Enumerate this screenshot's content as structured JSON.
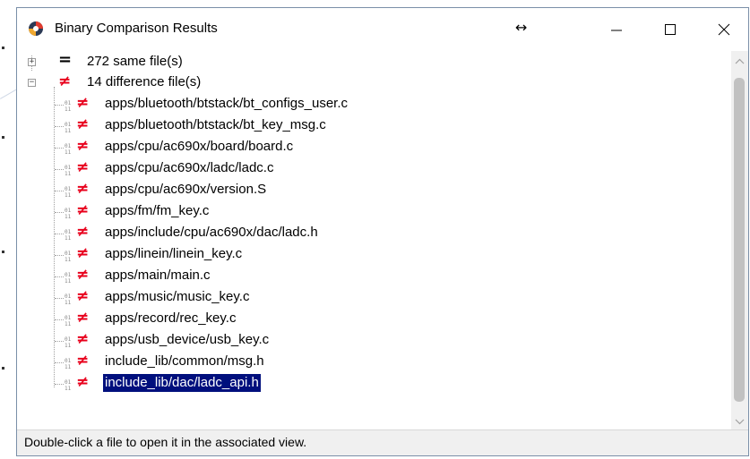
{
  "window": {
    "title": "Binary Comparison Results",
    "resize_cursor": "↔",
    "controls": [
      "minimize-icon",
      "maximize-icon",
      "close-icon"
    ]
  },
  "tree": {
    "groups": [
      {
        "symbol": "=",
        "label": "272 same file(s)",
        "expanded": false
      },
      {
        "symbol": "≠",
        "label": "14 difference file(s)",
        "expanded": true
      }
    ],
    "files": [
      "apps/bluetooth/btstack/bt_configs_user.c",
      "apps/bluetooth/btstack/bt_key_msg.c",
      "apps/cpu/ac690x/board/board.c",
      "apps/cpu/ac690x/ladc/ladc.c",
      "apps/cpu/ac690x/version.S",
      "apps/fm/fm_key.c",
      "apps/include/cpu/ac690x/dac/ladc.h",
      "apps/linein/linein_key.c",
      "apps/main/main.c",
      "apps/music/music_key.c",
      "apps/record/rec_key.c",
      "apps/usb_device/usb_key.c",
      "include_lib/common/msg.h",
      "include_lib/dac/ladc_api.h"
    ],
    "selected_file": "include_lib/dac/ladc_api.h",
    "file_symbol": "≠"
  },
  "status_bar": {
    "text": "Double-click a file to open it in the associated view."
  },
  "colors": {
    "difference_red": "#e8001c",
    "selection_bg": "#000f7d",
    "status_bg": "#f0f0f0"
  }
}
